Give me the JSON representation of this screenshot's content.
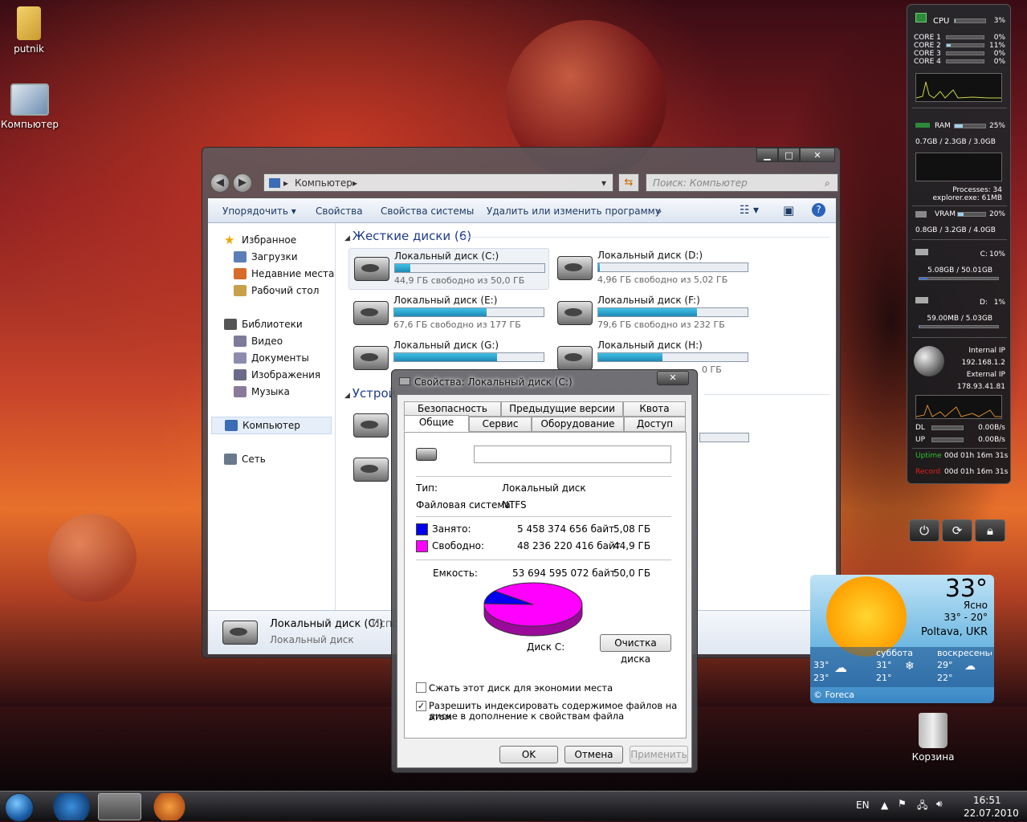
{
  "desktop": {
    "icons": [
      {
        "label": "putnik",
        "icon": "folder-icon"
      },
      {
        "label": "Компьютер",
        "icon": "computer-icon"
      },
      {
        "label": "Корзина",
        "icon": "recycle-bin-icon"
      }
    ]
  },
  "explorer": {
    "address": {
      "root_arrow": "▸",
      "location": "Компьютер",
      "tail_arrow": "▸",
      "dropdown": "▾"
    },
    "search_placeholder": "Поиск: Компьютер",
    "toolbar": [
      "Упорядочить ▾",
      "Свойства",
      "Свойства системы",
      "Удалить или изменить программу",
      "»"
    ],
    "sidebar": {
      "favorites": "Избранное",
      "favorites_items": [
        "Загрузки",
        "Недавние места",
        "Рабочий стол"
      ],
      "libraries": "Библиотеки",
      "libraries_items": [
        "Видео",
        "Документы",
        "Изображения",
        "Музыка"
      ],
      "computer": "Компьютер",
      "network": "Сеть"
    },
    "hard_drives_header": "Жесткие диски (6)",
    "devices_header": "Устрой",
    "drives": [
      {
        "name": "Локальный диск (C:)",
        "free": "44,9 ГБ свободно из 50,0 ГБ",
        "used_fraction": 0.1
      },
      {
        "name": "Локальный диск (D:)",
        "free": "4,96 ГБ свободно из 5,02 ГБ",
        "used_fraction": 0.01
      },
      {
        "name": "Локальный диск (E:)",
        "free": "67,6 ГБ свободно из 177 ГБ",
        "used_fraction": 0.62
      },
      {
        "name": "Локальный диск (F:)",
        "free": "79,6 ГБ свободно из 232 ГБ",
        "used_fraction": 0.66
      },
      {
        "name": "Локальный диск (G:)",
        "free": "",
        "used_fraction": 0.69
      },
      {
        "name": "Локальный диск (H:)",
        "free": "",
        "used_fraction": 0.43
      }
    ],
    "partial_free_h": "0 ГБ",
    "details": {
      "name": "Локальный диск (C:)",
      "name_tail": "Испо",
      "type": "Локальный диск"
    }
  },
  "dialog": {
    "title": "Свойства: Локальный диск (C:)",
    "close": "✕",
    "tabs_row1": [
      "Безопасность",
      "Предыдущие версии",
      "Квота"
    ],
    "tabs_row2": [
      "Общие",
      "Сервис",
      "Оборудование",
      "Доступ"
    ],
    "label_value": "",
    "type_label": "Тип:",
    "type_value": "Локальный диск",
    "fs_label": "Файловая система:",
    "fs_value": "NTFS",
    "used_label": "Занято:",
    "used_bytes": "5 458 374 656 байт",
    "used_gb": "5,08 ГБ",
    "free_label": "Свободно:",
    "free_bytes": "48 236 220 416 байт",
    "free_gb": "44,9 ГБ",
    "capacity_label": "Емкость:",
    "capacity_bytes": "53 694 595 072 байт",
    "capacity_gb": "50,0 ГБ",
    "disk_label": "Диск C:",
    "cleanup_button": "Очистка диска",
    "compress_label": "Сжать этот диск для экономии места",
    "compress_checked": false,
    "index_label_1": "Разрешить индексировать содержимое файлов на этом",
    "index_label_2": "диске в дополнение к свойствам файла",
    "index_checked": true,
    "ok": "OK",
    "cancel": "Отмена",
    "apply": "Применить",
    "used_color": "#0000ee",
    "free_color": "#ff00ff",
    "used_fraction": 0.1017
  },
  "gadget": {
    "cpu_label": "CPU",
    "cpu_value": "3%",
    "cpu_level": 0.03,
    "cores": [
      {
        "label": "CORE 1",
        "value": "0%",
        "level": 0.0
      },
      {
        "label": "CORE 2",
        "value": "11%",
        "level": 0.11
      },
      {
        "label": "CORE 3",
        "value": "0%",
        "level": 0.0
      },
      {
        "label": "CORE 4",
        "value": "0%",
        "level": 0.0
      }
    ],
    "ram_label": "RAM",
    "ram_value": "25%",
    "ram_level": 0.25,
    "ram_detail": "0.7GB / 2.3GB / 3.0GB",
    "processes": "Processes: 34",
    "top_process": "explorer.exe: 61MB",
    "vram_label": "VRAM",
    "vram_value": "20%",
    "vram_level": 0.2,
    "vram_detail": "0.8GB / 3.2GB / 4.0GB",
    "c_label": "C:",
    "c_value": "10%",
    "c_level": 0.1,
    "c_detail": "5.08GB / 50.01GB",
    "d_label": "D:",
    "d_value": "1%",
    "d_level": 0.01,
    "d_detail": "59.00MB / 5.03GB",
    "internal_ip_label": "Internal IP",
    "internal_ip": "192.168.1.2",
    "external_ip_label": "External IP",
    "external_ip": "178.93.41.81",
    "dl_label": "DL",
    "dl_value": "0.00B/s",
    "up_label": "UP",
    "up_value": "0.00B/s",
    "uptime_label": "Uptime",
    "uptime_value": "00d 01h 16m 31s",
    "record_label": "Record",
    "record_value": "00d 01h 16m 31s",
    "uptime_color": "#2ec22e",
    "record_color": "#e02020"
  },
  "weather": {
    "temp": "33°",
    "condition": "Ясно",
    "range": "33° - 20°",
    "city": "Poltava, UKR",
    "days": [
      {
        "name": "",
        "hi": "33°",
        "lo": "23°"
      },
      {
        "name": "суббота",
        "hi": "31°",
        "lo": "21°"
      },
      {
        "name": "воскресенье",
        "hi": "29°",
        "lo": "22°"
      }
    ],
    "provider": "© Foreca"
  },
  "taskbar": {
    "lang": "EN",
    "time": "16:51",
    "date": "22.07.2010"
  }
}
